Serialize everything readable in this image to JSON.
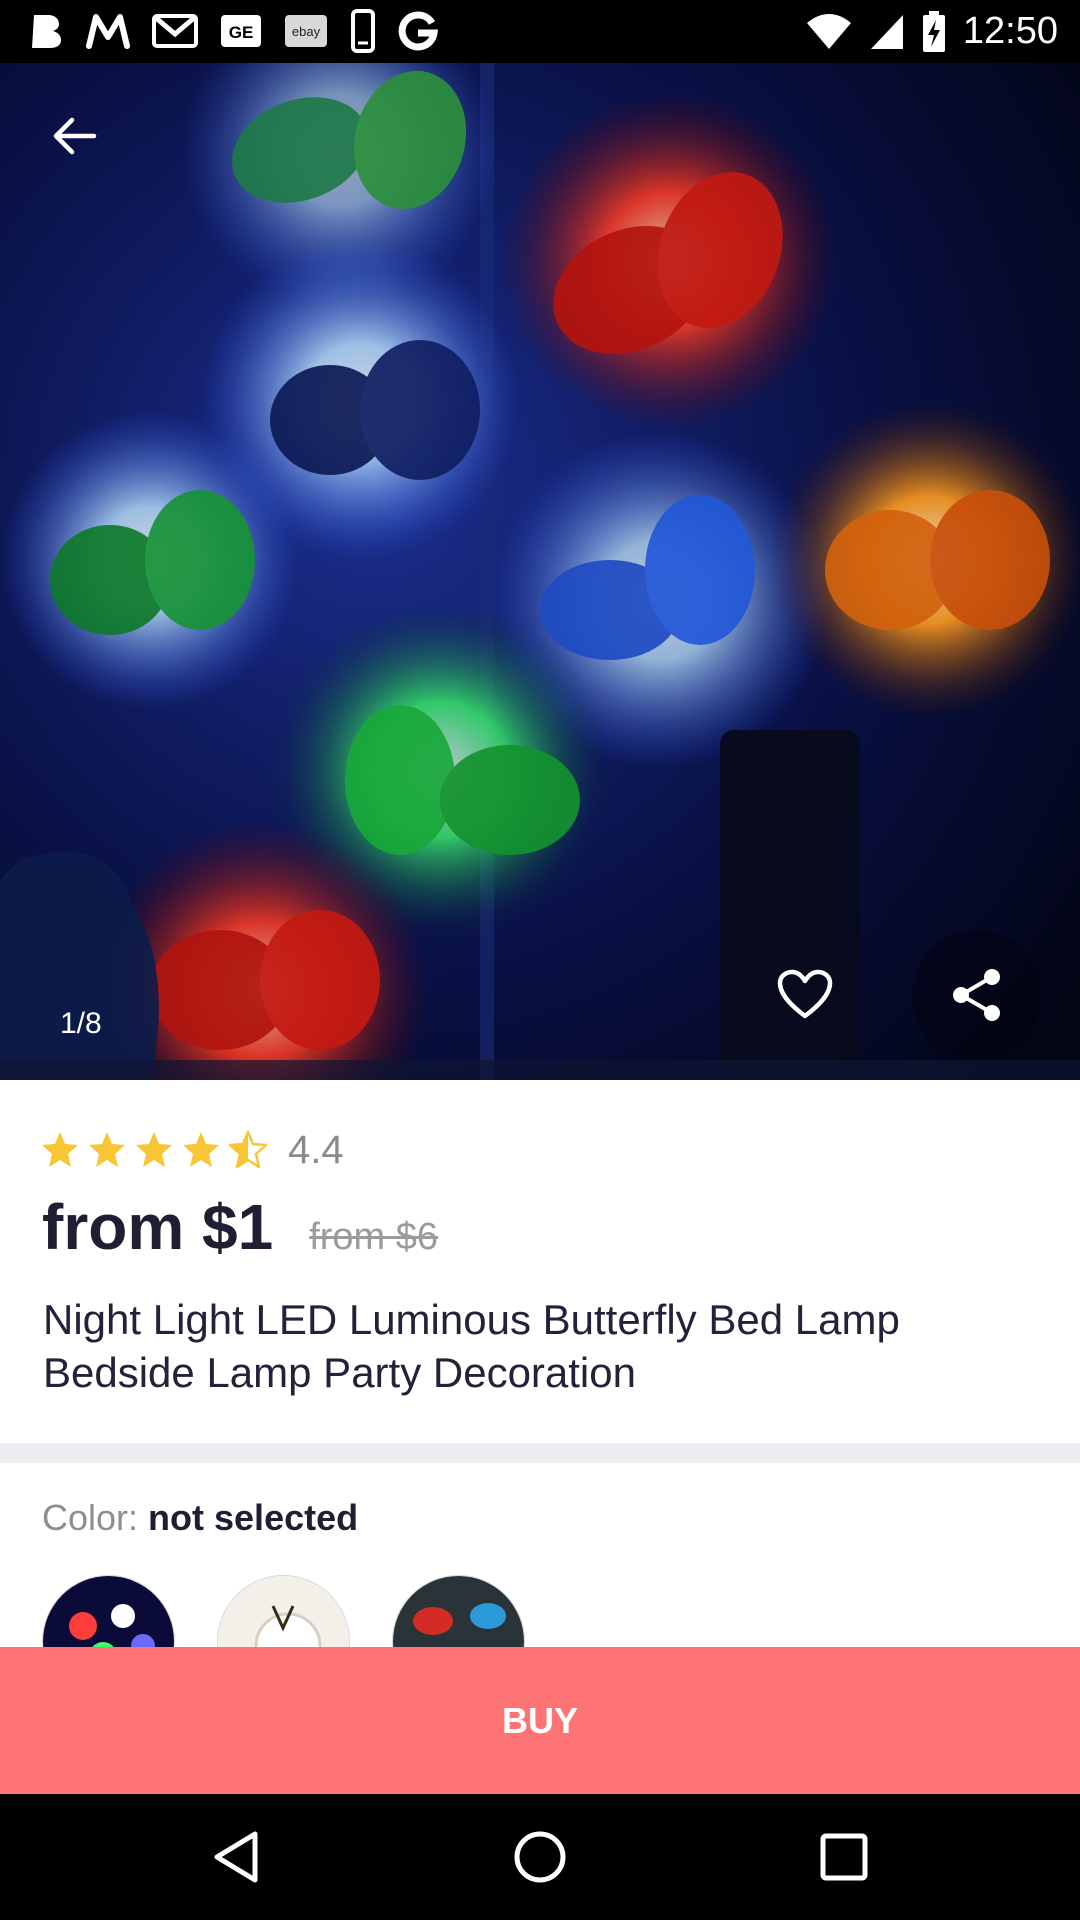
{
  "status_bar": {
    "time": "12:50",
    "notification_icons": [
      "b-app-icon",
      "m-app-icon",
      "gmail-icon",
      "ge-icon",
      "ebay-icon",
      "phone-icon",
      "google-icon"
    ],
    "ebay_label": "ebay"
  },
  "product": {
    "image_counter": "1/8",
    "rating": "4.4",
    "rating_value": 4.4,
    "price": "from $1",
    "old_price": "from $6",
    "title": "Night Light LED Luminous Butterfly Bed Lamp Bedside Lamp Party Decoration"
  },
  "options": {
    "color_key": "Color:",
    "color_value": "not selected",
    "swatch_count": 3
  },
  "buy_button": {
    "label": "BUY"
  },
  "colors": {
    "accent": "#fe7474",
    "star": "#f8c534",
    "text_dark": "#1f1f33",
    "text_muted": "#8d8d95"
  }
}
